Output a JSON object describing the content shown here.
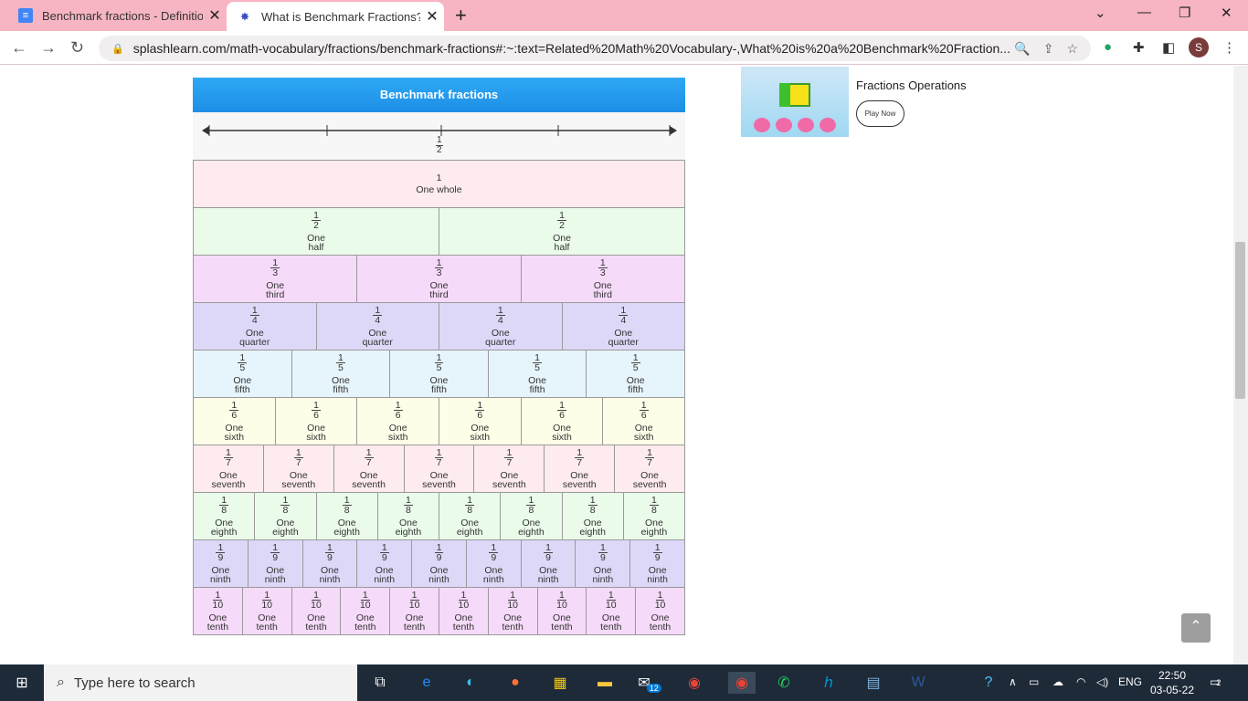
{
  "browser": {
    "tabs": [
      {
        "title": "Benchmark fractions - Definition",
        "icon": "google-docs-icon"
      },
      {
        "title": "What is Benchmark Fractions? - D",
        "icon": "splashlearn-icon"
      }
    ],
    "url": "splashlearn.com/math-vocabulary/fractions/benchmark-fractions#:~:text=Related%20Math%20Vocabulary-,What%20is%20a%20Benchmark%20Fraction...",
    "profile_initial": "S"
  },
  "figure": {
    "title": "Benchmark fractions",
    "number_line_label": {
      "num": "1",
      "den": "2"
    },
    "rows": [
      {
        "num": "1",
        "den": "",
        "name": [
          "One whole"
        ],
        "count": 1
      },
      {
        "num": "1",
        "den": "2",
        "name": [
          "One",
          "half"
        ],
        "count": 2
      },
      {
        "num": "1",
        "den": "3",
        "name": [
          "One",
          "third"
        ],
        "count": 3
      },
      {
        "num": "1",
        "den": "4",
        "name": [
          "One",
          "quarter"
        ],
        "count": 4
      },
      {
        "num": "1",
        "den": "5",
        "name": [
          "One",
          "fifth"
        ],
        "count": 5
      },
      {
        "num": "1",
        "den": "6",
        "name": [
          "One",
          "sixth"
        ],
        "count": 6
      },
      {
        "num": "1",
        "den": "7",
        "name": [
          "One",
          "seventh"
        ],
        "count": 7
      },
      {
        "num": "1",
        "den": "8",
        "name": [
          "One",
          "eighth"
        ],
        "count": 8
      },
      {
        "num": "1",
        "den": "9",
        "name": [
          "One",
          "ninth"
        ],
        "count": 9
      },
      {
        "num": "1",
        "den": "10",
        "name": [
          "One",
          "tenth"
        ],
        "count": 10
      }
    ],
    "row_colors": [
      "#fdebed",
      "#eafbe9",
      "#f6daf9",
      "#ded8f8",
      "#e6f4fb",
      "#fdfde8",
      "#fdebed",
      "#eafbe9",
      "#ded8f8",
      "#f6daf9"
    ]
  },
  "sidebar": {
    "game_title": "Fractions Operations",
    "play_label": "Play Now"
  },
  "taskbar": {
    "search_placeholder": "Type here to search",
    "language": "ENG",
    "time": "22:50",
    "date": "03-05-22",
    "mail_badge": "12",
    "notif_badge": "2"
  }
}
